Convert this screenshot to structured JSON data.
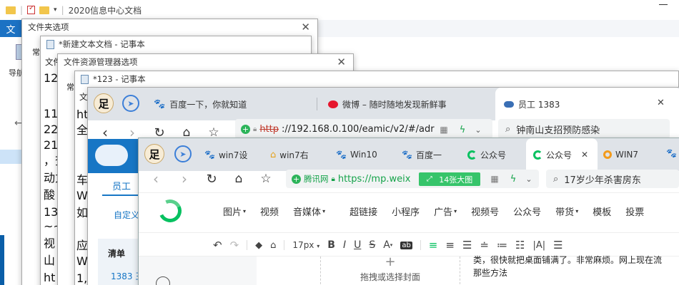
{
  "explorer": {
    "quick_icons": [
      "folder-icon",
      "checkbox-icon",
      "folder-icon"
    ],
    "title": "2020信息中心文档",
    "ribbon_file": "文",
    "nav_label": "导航"
  },
  "folder_options": {
    "title": "文件夹选项",
    "tab_label": "常"
  },
  "notepad_new": {
    "title": "*新建文本文档 - 记事本",
    "menu": "文件",
    "lines": [
      "12",
      "",
      "11",
      "22",
      " 21",
      "，查",
      "动力",
      "酸",
      "13",
      "~~",
      "视",
      "山",
      "ht"
    ]
  },
  "explorer_options": {
    "title": "文件资源管理器选项",
    "tab_label": "常"
  },
  "notepad_123": {
    "title": "*123 - 记事本",
    "menu": "文",
    "lines": [
      "ht",
      "全",
      "",
      "车",
      "W",
      "如",
      "",
      "应",
      "W",
      "1,"
    ]
  },
  "browser1": {
    "tabs": [
      {
        "label": "百度一下，你就知道",
        "icon": "baidu-paw-icon"
      },
      {
        "label": "微博 – 随时随地发现新鲜事",
        "icon": "weibo-icon"
      },
      {
        "label": "员工 1383",
        "icon": "cloud-icon"
      }
    ],
    "close": "✕",
    "url_prefix": "http",
    "url_rest": "://192.168.0.100/eamic/v2/#/adr",
    "search": "钟南山支招预防感染",
    "app_nav": "员工",
    "app_sub": "自定义",
    "list_header": "清单",
    "list_item": "1383 王"
  },
  "browser2": {
    "tabs": [
      {
        "label": "win7设",
        "icon": "baidu-paw-icon"
      },
      {
        "label": "win7右",
        "icon": "house-icon"
      },
      {
        "label": "Win10",
        "icon": "baidu-paw-icon"
      },
      {
        "label": "百度一",
        "icon": "baidu-paw-icon"
      },
      {
        "label": "公众号",
        "icon": "wechat-mp-icon"
      },
      {
        "label": "公众号",
        "icon": "wechat-mp-icon"
      },
      {
        "label": "WIN7",
        "icon": "search-o-icon"
      }
    ],
    "active_close": "✕",
    "site_tag": "腾讯网",
    "url": "https://mp.weix",
    "promo": "14张大图",
    "search": "17岁少年杀害房东",
    "menus": [
      "图片",
      "视频",
      "音媒体",
      "超链接",
      "小程序",
      "广告",
      "视频号",
      "公众号",
      "带货",
      "模板",
      "投票"
    ],
    "menus_caret": [
      true,
      false,
      true,
      false,
      false,
      true,
      false,
      false,
      true,
      false,
      false
    ],
    "font_size": "17px",
    "cover_hint": "拖拽或选择封面",
    "body_line1": "类，很快就把桌面铺满了。非常麻烦。网上现在流",
    "body_line2": "那些方法"
  },
  "colors": {
    "accent_green": "#07c160",
    "brand_blue": "#1a73e8",
    "taskbar_blue": "#0a5ea8"
  }
}
